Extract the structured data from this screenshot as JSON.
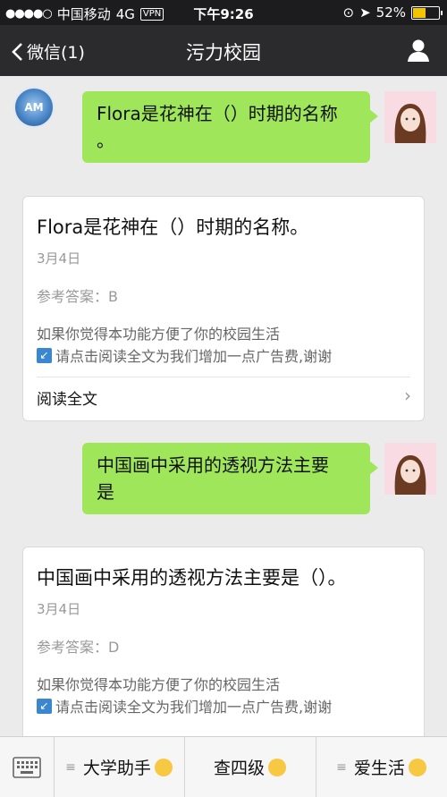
{
  "status": {
    "carrier": "中国移动",
    "network": "4G",
    "vpn": "VPN",
    "time": "下午9:26",
    "battery": "52%",
    "battery_level": 0.52
  },
  "nav": {
    "back_label": "微信(1)",
    "title": "污力校园"
  },
  "left_avatar_text": "AM",
  "messages": [
    {
      "bubble_line1": "Flora是花神在（）时期的名称",
      "bubble_line2": "。"
    },
    {
      "bubble_line1": "中国画中采用的透视方法主要",
      "bubble_line2": "是"
    }
  ],
  "cards": [
    {
      "title": "Flora是花神在（）时期的名称。",
      "date": "3月4日",
      "answer": "参考答案：B",
      "note1": "如果你觉得本功能方便了你的校园生活",
      "note2": "请点击阅读全文为我们增加一点广告费,谢谢",
      "read_more": "阅读全文"
    },
    {
      "title": "中国画中采用的透视方法主要是（）。",
      "date": "3月4日",
      "answer": "参考答案：D",
      "note1": "如果你觉得本功能方便了你的校园生活",
      "note2": "请点击阅读全文为我们增加一点广告费,谢谢"
    }
  ],
  "menu": {
    "item1": "大学助手",
    "item2": "查四级",
    "item3": "爱生活"
  }
}
